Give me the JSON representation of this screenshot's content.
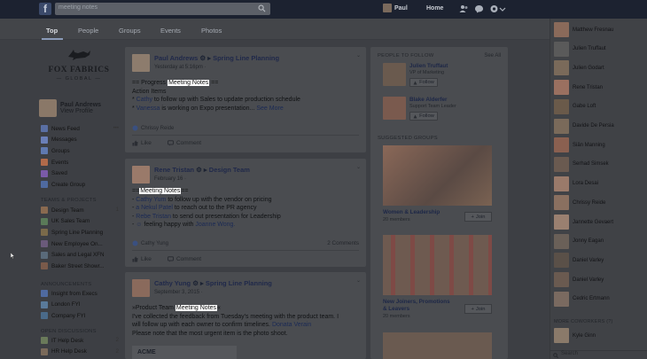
{
  "topbar": {
    "logo": "f",
    "search_value": "meeting notes",
    "profile_name": "Paul",
    "home_label": "Home"
  },
  "tabs": [
    {
      "label": "Top",
      "active": true
    },
    {
      "label": "People"
    },
    {
      "label": "Groups"
    },
    {
      "label": "Events"
    },
    {
      "label": "Photos"
    }
  ],
  "brand": {
    "name": "FOX FABRICS",
    "sub": "GLOBAL"
  },
  "me": {
    "name": "Paul Andrews",
    "link": "View Profile"
  },
  "sidebar": {
    "main": [
      {
        "label": "News Feed",
        "color": "#5a6fa3",
        "caret": "•••"
      },
      {
        "label": "Messages",
        "color": "#6a7fb8"
      },
      {
        "label": "Groups",
        "color": "#5f79b0"
      },
      {
        "label": "Events",
        "color": "#b06a4a"
      },
      {
        "label": "Saved",
        "color": "#7a5aa8"
      },
      {
        "label": "Create Group",
        "color": "#4f6aa0"
      }
    ],
    "teams_header": "TEAMS & PROJECTS",
    "teams": [
      {
        "label": "Design Team",
        "count": "1",
        "color": "#8a6a50"
      },
      {
        "label": "UK Sales Team",
        "color": "#5a7a58"
      },
      {
        "label": "Spring Line Planning",
        "color": "#7a6a4a"
      },
      {
        "label": "New Employee On...",
        "color": "#6a5a7a"
      },
      {
        "label": "Sales and Legal XFN",
        "color": "#5a6a7a"
      },
      {
        "label": "Baker Street Showr...",
        "color": "#7a5a4a"
      }
    ],
    "announce_header": "ANNOUNCEMENTS",
    "announcements": [
      {
        "label": "Insight from Execs",
        "color": "#4f6aa0"
      },
      {
        "label": "London FYI",
        "color": "#5a7a9a"
      },
      {
        "label": "Company FYI",
        "color": "#4a6a8a"
      }
    ],
    "open_header": "OPEN DISCUSSIONS",
    "open": [
      {
        "label": "IT Help Desk",
        "count": "2",
        "color": "#6a7a5a"
      },
      {
        "label": "HR Help Desk",
        "count": "2",
        "color": "#7a6a5a"
      }
    ]
  },
  "posts": [
    {
      "author": "Paul Andrews",
      "target": "Spring Line Planning",
      "time": "Yesterday at 5:16pm · ",
      "lines": [
        {
          "pre": "== Progress ",
          "hl": "Meeting Notes",
          "post": " =="
        },
        {
          "text": "Action Items"
        },
        {
          "bullet": "* ",
          "link": "Cathy",
          "text": " to follow up with Sales to update production schedule"
        },
        {
          "bullet": "* ",
          "link": "Vanessa",
          "text": " is working on Expo presentation... ",
          "more": "See More"
        }
      ],
      "seen": "Chrissy Reide",
      "like": "Like",
      "comment": "Comment"
    },
    {
      "author": "Rene Tristan",
      "target": "Design Team",
      "time": "February 16 · ",
      "lines": [
        {
          "pre": "==",
          "hl": "Meeting Notes",
          "post": "=="
        },
        {
          "bullet": "- ",
          "link": "Cathy Yum",
          "text": " to follow up with the vendor on pricing"
        },
        {
          "bullet": "- ",
          "link": "a Nekul Patel",
          "text": " to reach out to the PR agency"
        },
        {
          "bullet": "- ",
          "link": "Rebe Tristan",
          "text": " to send out presentation for Leadership"
        },
        {
          "bullet": "- ",
          "emoji": "☺",
          "text": " feeling happy with ",
          "link2": "Joanne Wong."
        }
      ],
      "seen": "Cathy Yung",
      "comments_count": "2 Comments",
      "like": "Like",
      "comment": "Comment"
    },
    {
      "author": "Cathy Yung",
      "target": "Spring Line Planning",
      "time": "September 3, 2015 · ",
      "lines": [
        {
          "pre": "»Product Team ",
          "hl": "Meeting Notes",
          "post": "«"
        },
        {
          "text": "I've collected the feedback from Tuesday's meeting with the product team. I"
        },
        {
          "text": "will follow up with each owner to confirm timelines. ",
          "link": "Donata Verain"
        },
        {
          "text": "Please note that the most urgent item is the photo shoot."
        }
      ],
      "attachment": "ACME"
    }
  ],
  "right": {
    "people_header": "PEOPLE TO FOLLOW",
    "see_all": "See All",
    "people": [
      {
        "name": "Julien Truffaut",
        "role": "VP of Marketing",
        "follow": "Follow"
      },
      {
        "name": "Blake Alderfer",
        "role": "Support Team Leader",
        "follow": "Follow"
      }
    ],
    "groups_header": "SUGGESTED GROUPS",
    "groups": [
      {
        "name": "Women & Leadership",
        "members": "20 members",
        "join": "Join"
      },
      {
        "name": "New Joiners, Promotions & Leavers",
        "members": "20 members",
        "join": "Join"
      }
    ]
  },
  "chat": {
    "people": [
      {
        "name": "Matthew Fresnau",
        "color": "#8a6a5a"
      },
      {
        "name": "Julien Truffaut",
        "color": "#5a5a5a"
      },
      {
        "name": "Julien Godart",
        "color": "#7a6a5a"
      },
      {
        "name": "Rene Tristan",
        "color": "#9a7060"
      },
      {
        "name": "Gabe Loft",
        "color": "#6a5a4a"
      },
      {
        "name": "Davide De Persia",
        "color": "#7a6a5a"
      },
      {
        "name": "Siân Manning",
        "color": "#8a6050"
      },
      {
        "name": "Serhad Simsek",
        "color": "#6a5a50"
      },
      {
        "name": "Lora Desai",
        "color": "#9a7a6a"
      },
      {
        "name": "Chrissy Reide",
        "color": "#8a7060"
      },
      {
        "name": "Jannette Gevaert",
        "color": "#9a8070"
      },
      {
        "name": "Jonny Eagan",
        "color": "#6a6058"
      },
      {
        "name": "Daniel Varley",
        "color": "#5a5048"
      },
      {
        "name": "Daniel Varley",
        "color": "#6a5a50"
      },
      {
        "name": "Cedric Ertmann",
        "color": "#7a6a60"
      }
    ],
    "more_header": "MORE COWORKERS (?)",
    "more": [
      {
        "name": "Kyle Ginn",
        "color": "#8a7a6a"
      }
    ],
    "search_placeholder": "Search"
  }
}
